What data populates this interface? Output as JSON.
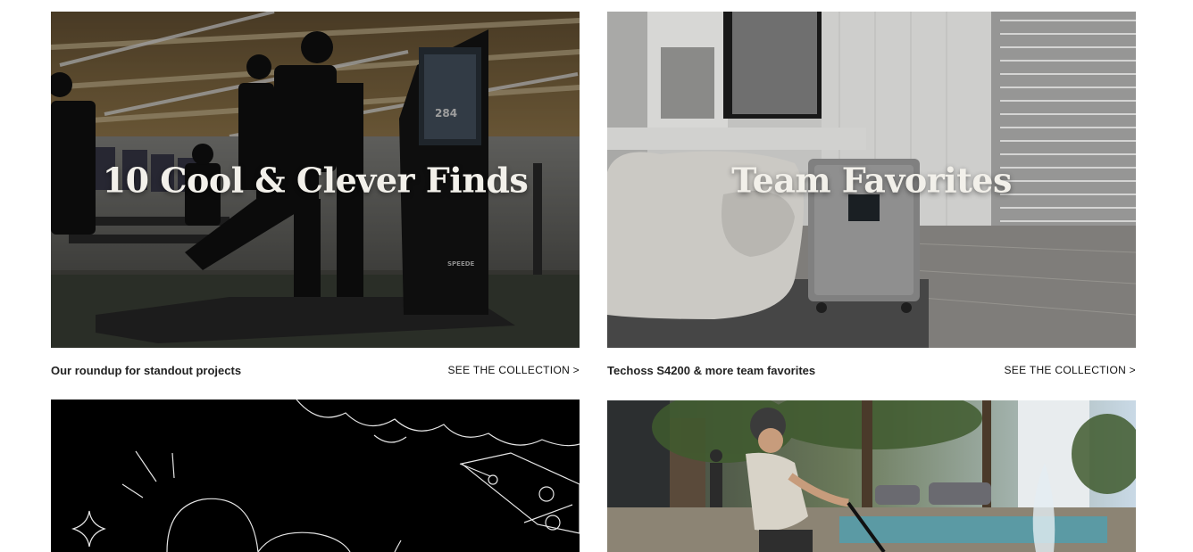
{
  "cards": [
    {
      "title": "10 Cool & Clever Finds",
      "description": "Our roundup for standout projects",
      "link_label": "SEE THE COLLECTION >",
      "image_icon": "gym-training-photo",
      "device_label": "SPEEDE",
      "screen_value": "284"
    },
    {
      "title": "Team Favorites",
      "description": "Techoss S4200 & more team favorites",
      "link_label": "SEE THE COLLECTION >",
      "image_icon": "interior-power-station-photo"
    },
    {
      "title": "",
      "image_icon": "sale-doodle-illustration"
    },
    {
      "title": "",
      "image_icon": "electric-scooter-rider-photo"
    }
  ],
  "colors": {
    "text": "#222222",
    "title_overlay": "#f2f0ea",
    "doodle_bg": "#000000"
  }
}
